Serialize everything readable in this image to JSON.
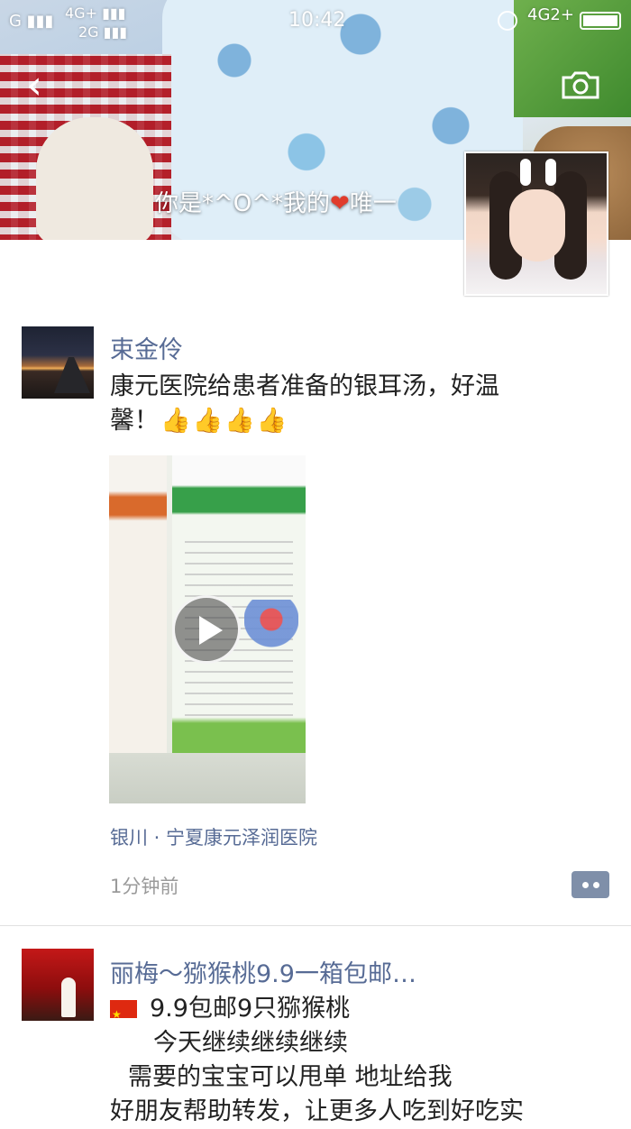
{
  "status_bar": {
    "carrier": "G",
    "network_primary": "4G+",
    "network_secondary": "2G",
    "time": "10:42",
    "network_right": "4G2+"
  },
  "cover": {
    "signature_prefix": "你是*^O^*我的",
    "signature_heart": "❤",
    "signature_suffix": "唯一"
  },
  "posts": [
    {
      "author": "束金伶",
      "text_line1": "康元医院给患者准备的银耳汤，好温",
      "text_line2": "馨！",
      "thumbs": [
        "👍",
        "👍",
        "👍",
        "👍"
      ],
      "location": "银川 · 宁夏康元泽润医院",
      "time": "1分钟前"
    },
    {
      "author": "丽梅～猕猴桃9.9一箱包邮…",
      "lines": [
        "9.9包邮9只猕猴桃",
        "今天继续继续继续",
        "需要的宝宝可以甩单 地址给我",
        "好朋友帮助转发，让更多人吃到好吃实"
      ]
    }
  ],
  "colors": {
    "name_link": "#576b95",
    "timestamp": "#9a9a9a",
    "comment_button": "#7f8fa9"
  },
  "icons": [
    "back-chevron-icon",
    "camera-icon",
    "play-icon",
    "comment-icon",
    "china-flag-icon",
    "thumbs-up-icon"
  ]
}
